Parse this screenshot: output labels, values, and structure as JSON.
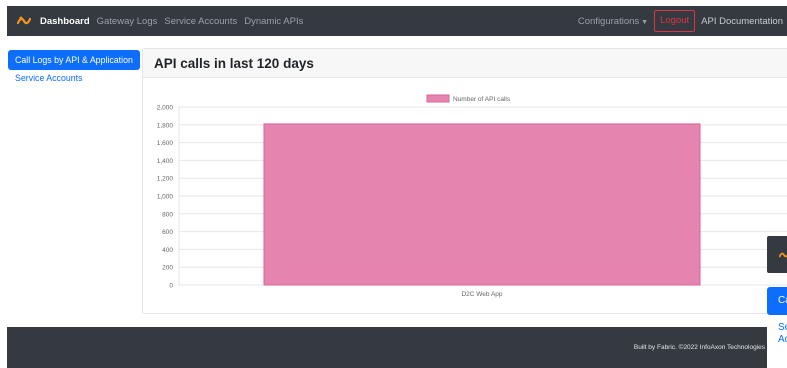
{
  "nav": {
    "brand_links": [
      "Dashboard",
      "Gateway Logs",
      "Service Accounts",
      "Dynamic APIs"
    ],
    "configurations_label": "Configurations",
    "logout_label": "Logout",
    "api_docs_label": "API Documentation"
  },
  "sidebar": {
    "items": [
      {
        "label": "Call Logs by API & Application",
        "active": true
      },
      {
        "label": "Service Accounts",
        "active": false
      }
    ]
  },
  "card": {
    "title": "API calls in last 120 days"
  },
  "chart_data": {
    "type": "bar",
    "categories": [
      "D2C Web App"
    ],
    "series": [
      {
        "name": "Number of API calls",
        "values": [
          1810
        ],
        "color": "#e684b0"
      }
    ],
    "ylim": [
      0,
      2000
    ],
    "yticks": [
      0,
      200,
      400,
      600,
      800,
      1000,
      1200,
      1400,
      1600,
      1800,
      2000
    ],
    "ytick_labels": [
      "0",
      "200",
      "400",
      "600",
      "800",
      "1,000",
      "1,200",
      "1,400",
      "1,600",
      "1,800",
      "2,000"
    ],
    "grid": true,
    "legend": "top-center"
  },
  "footer": {
    "text": "Built by Fabric. ©2022 InfoAxon Technologies"
  },
  "mini_window": {
    "button_label": "Call Logs by API & Application",
    "link_label": "Service Accounts"
  },
  "colors": {
    "accent": "#0d6efd",
    "dark": "#343a40",
    "danger": "#dc3545",
    "logo": "#f7941d"
  }
}
